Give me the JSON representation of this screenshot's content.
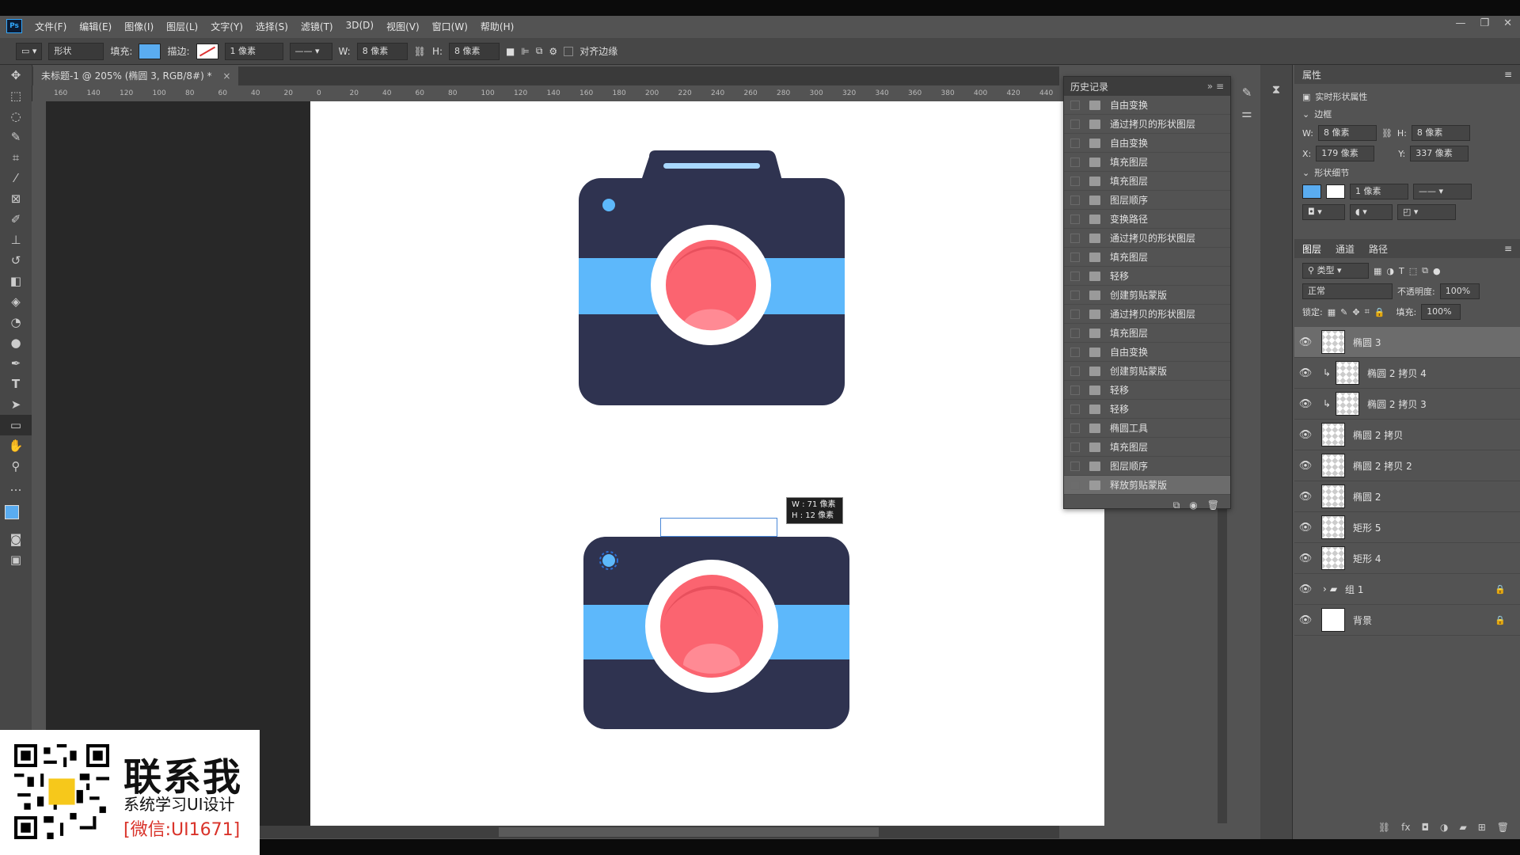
{
  "menu": [
    "文件(F)",
    "编辑(E)",
    "图像(I)",
    "图层(L)",
    "文字(Y)",
    "选择(S)",
    "滤镜(T)",
    "3D(D)",
    "视图(V)",
    "窗口(W)",
    "帮助(H)"
  ],
  "options": {
    "mode": "形状",
    "fill_label": "填充:",
    "stroke_label": "描边:",
    "stroke_width": "1 像素",
    "w_label": "W:",
    "w_value": "8 像素",
    "h_label": "H:",
    "h_value": "8 像素",
    "align_edges": "对齐边缘"
  },
  "document": {
    "tab_title": "未标题-1 @ 205% (椭圆 3, RGB/8#) *"
  },
  "ruler_ticks": [
    "160",
    "140",
    "120",
    "100",
    "80",
    "60",
    "40",
    "20",
    "0",
    "20",
    "40",
    "60",
    "80",
    "100",
    "120",
    "140",
    "160",
    "180",
    "200",
    "220",
    "240",
    "260",
    "280",
    "300",
    "320",
    "340",
    "360",
    "380",
    "400",
    "420",
    "440"
  ],
  "size_tooltip": {
    "w": "W : 71 像素",
    "h": "H : 12 像素"
  },
  "history": {
    "title": "历史记录",
    "items": [
      "自由变换",
      "通过拷贝的形状图层",
      "自由变换",
      "填充图层",
      "填充图层",
      "图层顺序",
      "变换路径",
      "通过拷贝的形状图层",
      "填充图层",
      "轻移",
      "创建剪贴蒙版",
      "通过拷贝的形状图层",
      "填充图层",
      "自由变换",
      "创建剪贴蒙版",
      "轻移",
      "轻移",
      "椭圆工具",
      "填充图层",
      "图层顺序",
      "释放剪贴蒙版"
    ],
    "selected_index": 20
  },
  "properties": {
    "title": "属性",
    "subtitle": "实时形状属性",
    "section_bounds": "边框",
    "w": "8 像素",
    "h": "8 像素",
    "x": "179 像素",
    "y": "337 像素",
    "section_shape": "形状细节",
    "stroke_width": "1 像素"
  },
  "layers_panel": {
    "tabs": [
      "图层",
      "通道",
      "路径"
    ],
    "filter": "类型",
    "blend_mode": "正常",
    "opacity_label": "不透明度:",
    "opacity": "100%",
    "lock_label": "锁定:",
    "fill_label": "填充:",
    "fill": "100%",
    "layers": [
      {
        "name": "椭圆 3",
        "selected": true,
        "clip": false
      },
      {
        "name": "椭圆 2 拷贝 4",
        "selected": false,
        "clip": true
      },
      {
        "name": "椭圆 2 拷贝 3",
        "selected": false,
        "clip": true
      },
      {
        "name": "椭圆 2 拷贝",
        "selected": false,
        "clip": false
      },
      {
        "name": "椭圆 2 拷贝 2",
        "selected": false,
        "clip": false
      },
      {
        "name": "椭圆 2",
        "selected": false,
        "clip": false
      },
      {
        "name": "矩形 5",
        "selected": false,
        "clip": false
      },
      {
        "name": "矩形 4",
        "selected": false,
        "clip": false
      },
      {
        "name": "组 1",
        "selected": false,
        "clip": false,
        "folder": true,
        "locked": true
      },
      {
        "name": "背景",
        "selected": false,
        "clip": false,
        "white": true,
        "locked": true
      }
    ]
  },
  "promo": {
    "title": "联系我",
    "subtitle": "系统学习UI设计",
    "wechat": "[微信:UI1671]"
  },
  "colors": {
    "camera_body": "#2f3350",
    "camera_strap": "#5db8fb",
    "lens_ring": "#ffffff",
    "lens": "#fb6470",
    "fill_swatch": "#5aacf0",
    "accent_blue": "#31a8ff"
  }
}
